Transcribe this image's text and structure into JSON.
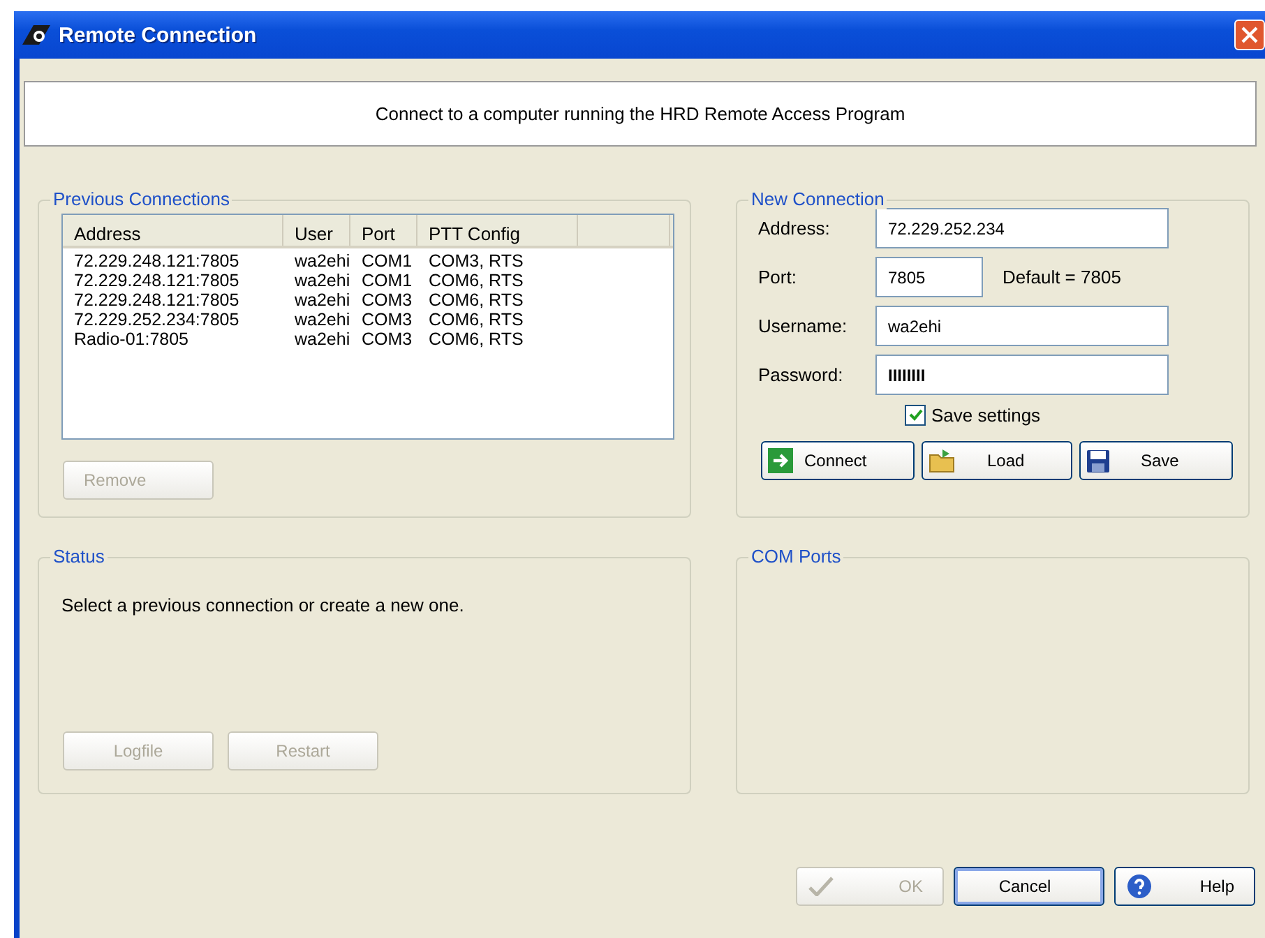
{
  "window": {
    "title": "Remote Connection"
  },
  "header": {
    "text": "Connect to a computer running the HRD Remote Access Program"
  },
  "previous_connections": {
    "title": "Previous Connections",
    "columns": [
      "Address",
      "User",
      "Port",
      "PTT Config"
    ],
    "rows": [
      {
        "cells": [
          "72.229.248.121:7805",
          "wa2ehi",
          "COM1",
          "COM3, RTS"
        ]
      },
      {
        "cells": [
          "72.229.248.121:7805",
          "wa2ehi",
          "COM1",
          "COM6, RTS"
        ]
      },
      {
        "cells": [
          "72.229.248.121:7805",
          "wa2ehi",
          "COM3",
          "COM6, RTS"
        ]
      },
      {
        "cells": [
          "72.229.252.234:7805",
          "wa2ehi",
          "COM3",
          "COM6, RTS"
        ]
      },
      {
        "cells": [
          "Radio-01:7805",
          "wa2ehi",
          "COM3",
          "COM6, RTS"
        ]
      }
    ],
    "remove_button": {
      "label": "Remove",
      "disabled": true
    }
  },
  "new_connection": {
    "title": "New Connection",
    "address": {
      "label": "Address:",
      "value": "72.229.252.234"
    },
    "port": {
      "label": "Port:",
      "value": "7805",
      "hint": "Default = 7805"
    },
    "username": {
      "label": "Username:",
      "value": "wa2ehi"
    },
    "password": {
      "label": "Password:",
      "value": "IIIIIIII"
    },
    "save_settings": {
      "label": "Save settings",
      "checked": true
    },
    "buttons": [
      {
        "kind": "connect",
        "label": "Connect",
        "disabled": false
      },
      {
        "kind": "load",
        "label": "Load",
        "disabled": false
      },
      {
        "kind": "save",
        "label": "Save",
        "disabled": false
      }
    ]
  },
  "status": {
    "title": "Status",
    "message": "Select a previous connection or create a new one.",
    "buttons": [
      {
        "label": "Logfile",
        "disabled": true
      },
      {
        "label": "Restart",
        "disabled": true
      }
    ]
  },
  "com_ports": {
    "title": "COM Ports"
  },
  "footer_buttons": [
    {
      "kind": "ok",
      "label": "OK",
      "disabled": true,
      "default": false
    },
    {
      "kind": "cancel",
      "label": "Cancel",
      "disabled": false,
      "default": true
    },
    {
      "kind": "help",
      "label": "Help",
      "disabled": false,
      "default": false
    }
  ]
}
